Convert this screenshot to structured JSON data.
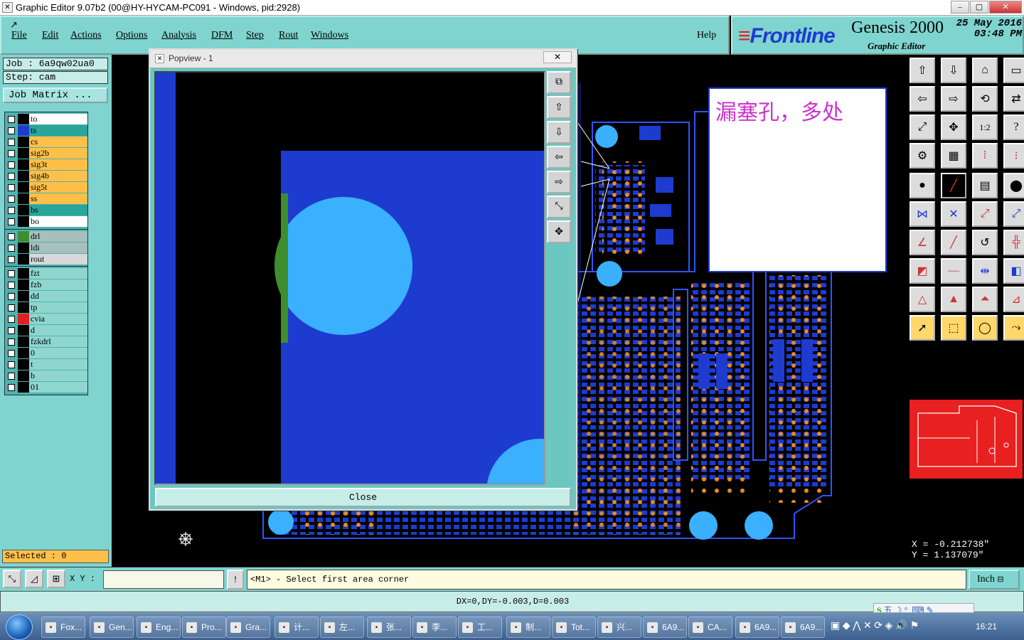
{
  "window": {
    "title": "Graphic Editor 9.07b2 (00@HY-HYCAM-PC091 - Windows, pid:2928)"
  },
  "menu": {
    "items": [
      "File",
      "Edit",
      "Actions",
      "Options",
      "Analysis",
      "DFM",
      "Step",
      "Rout",
      "Windows"
    ],
    "help": "Help"
  },
  "brand": {
    "logo": "Frontline",
    "product": "Genesis 2000",
    "editor": "Graphic Editor",
    "date": "25 May 2016",
    "time": "03:48 PM"
  },
  "job": {
    "job_label": "Job  :  6a9qw02ua0",
    "step_label": "Step: cam",
    "matrix_button": "Job Matrix ..."
  },
  "layers": {
    "group1": [
      {
        "name": "to",
        "bg": "#ffffff",
        "swatch": "#000000"
      },
      {
        "name": "ts",
        "bg": "#2aa59a",
        "swatch": "#1e3bd0"
      },
      {
        "name": "cs",
        "bg": "#ffc04a",
        "swatch": "#000000"
      },
      {
        "name": "sig2b",
        "bg": "#ffc04a",
        "swatch": "#000000"
      },
      {
        "name": "sig3t",
        "bg": "#ffc04a",
        "swatch": "#000000"
      },
      {
        "name": "sig4b",
        "bg": "#ffc04a",
        "swatch": "#000000"
      },
      {
        "name": "sig5t",
        "bg": "#ffc04a",
        "swatch": "#000000"
      },
      {
        "name": "ss",
        "bg": "#ffc04a",
        "swatch": "#000000"
      },
      {
        "name": "bs",
        "bg": "#2aa59a",
        "swatch": "#000000"
      },
      {
        "name": "bo",
        "bg": "#ffffff",
        "swatch": "#000000"
      }
    ],
    "group2": [
      {
        "name": "drl",
        "bg": "#a7c0bd",
        "swatch": "#3e8e2e"
      },
      {
        "name": "ldi",
        "bg": "#a7c0bd",
        "swatch": "#000000"
      },
      {
        "name": "rout",
        "bg": "#d8d8d8",
        "swatch": "#000000"
      }
    ],
    "group3": [
      {
        "name": "fzt",
        "bg": "#8fd6cf",
        "swatch": "#000000"
      },
      {
        "name": "fzb",
        "bg": "#8fd6cf",
        "swatch": "#000000"
      },
      {
        "name": "dd",
        "bg": "#8fd6cf",
        "swatch": "#000000"
      },
      {
        "name": "tp",
        "bg": "#8fd6cf",
        "swatch": "#000000"
      },
      {
        "name": "cvia",
        "bg": "#8fd6cf",
        "swatch": "#e02020"
      },
      {
        "name": "d",
        "bg": "#8fd6cf",
        "swatch": "#000000"
      },
      {
        "name": "fzkdrl",
        "bg": "#8fd6cf",
        "swatch": "#000000"
      },
      {
        "name": "0",
        "bg": "#8fd6cf",
        "swatch": "#000000"
      },
      {
        "name": "t",
        "bg": "#8fd6cf",
        "swatch": "#000000"
      },
      {
        "name": "b",
        "bg": "#8fd6cf",
        "swatch": "#000000"
      },
      {
        "name": "01",
        "bg": "#8fd6cf",
        "swatch": "#000000"
      }
    ]
  },
  "selected": "Selected : 0",
  "popview": {
    "title": "Popview - 1",
    "close": "Close"
  },
  "annotation": {
    "text": "漏塞孔，多处"
  },
  "coords": {
    "x": "X = -0.212738\"",
    "y": "Y =  1.137079\""
  },
  "bottom": {
    "xy_label": "X Y :",
    "prompt": "<M1> - Select first area corner",
    "unit": "Inch",
    "status": "DX=0,DY=-0.003,D=0.003"
  },
  "taskbar": {
    "tasks": [
      "Fox...",
      "Gen...",
      "Eng...",
      "Pro...",
      "Gra...",
      "计...",
      "左...",
      "张...",
      "李...",
      "工...",
      "制...",
      "Tot...",
      "兴...",
      "6A9...",
      "CA...",
      "6A9...",
      "6A9..."
    ],
    "ime": "五 ☽ °, ⌨ ✎",
    "clock": "16:21"
  },
  "colors": {
    "panel": "#7fd4cf",
    "copper": "#1e3bd0",
    "pad_light": "#3ab0ff",
    "drill": "#e88a20",
    "annotation": "#cc33cc"
  }
}
